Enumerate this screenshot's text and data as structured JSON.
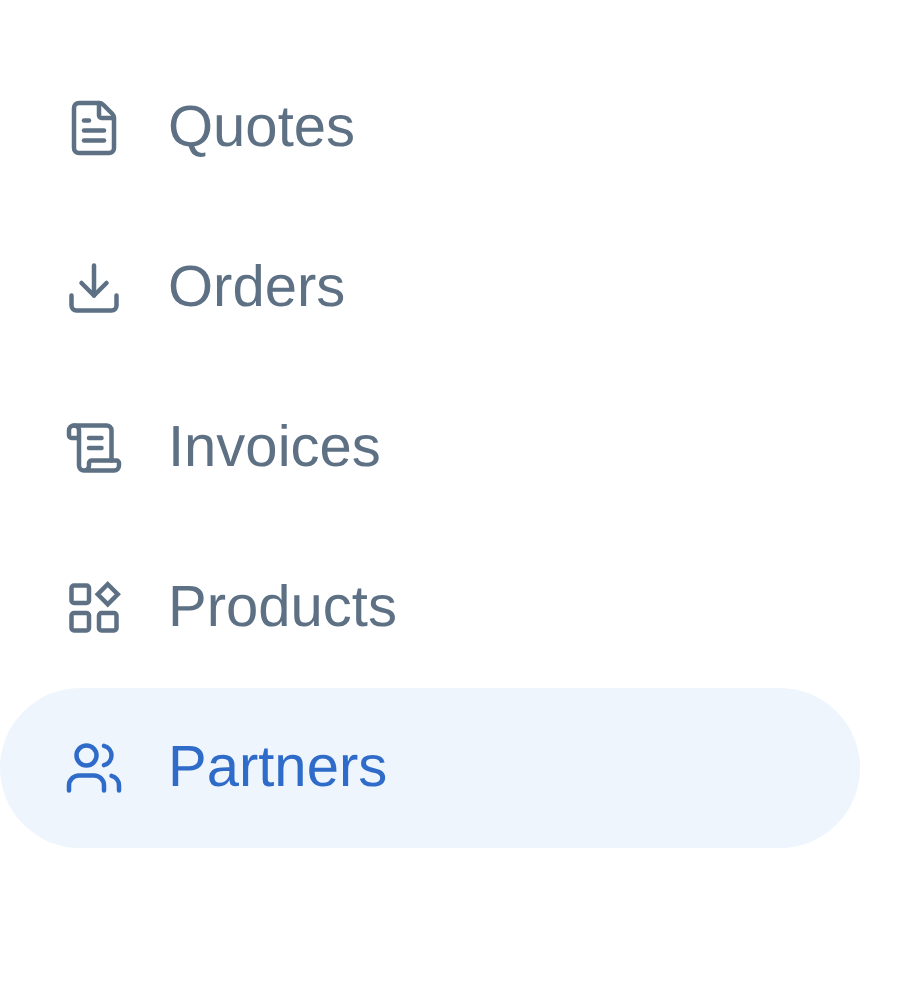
{
  "sidebar": {
    "items": [
      {
        "label": "Quotes",
        "kind": "quotes",
        "selected": false
      },
      {
        "label": "Orders",
        "kind": "orders",
        "selected": false
      },
      {
        "label": "Invoices",
        "kind": "invoices",
        "selected": false
      },
      {
        "label": "Products",
        "kind": "products",
        "selected": false
      },
      {
        "label": "Partners",
        "kind": "partners",
        "selected": true
      }
    ]
  }
}
